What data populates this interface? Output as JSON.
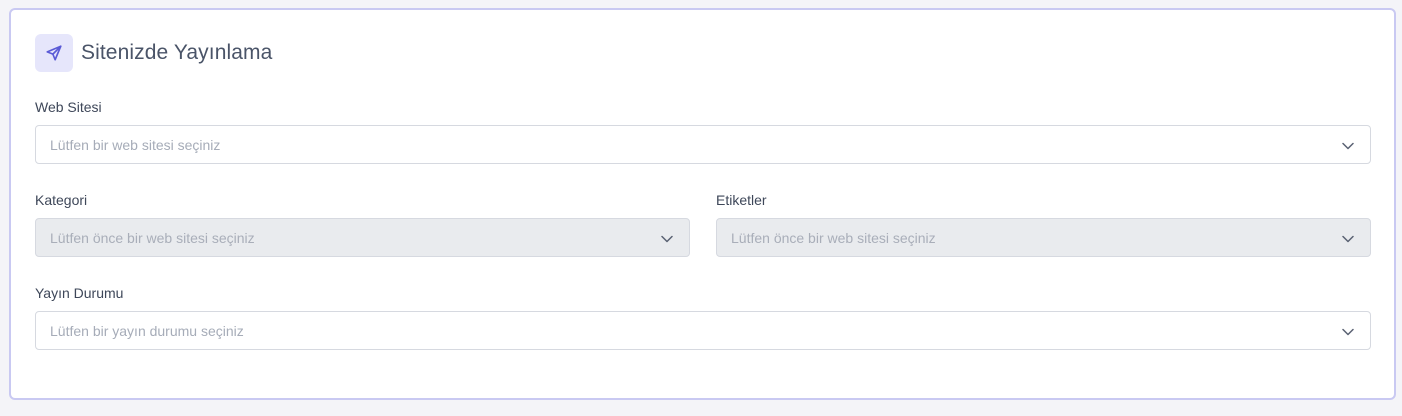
{
  "header": {
    "title": "Sitenizde Yayınlama",
    "icon": "paper-plane-icon",
    "icon_color": "#5b5bd6",
    "icon_bg": "#e6e6fb"
  },
  "fields": {
    "website": {
      "label": "Web Sitesi",
      "placeholder": "Lütfen bir web sitesi seçiniz",
      "disabled": false
    },
    "category": {
      "label": "Kategori",
      "placeholder": "Lütfen önce bir web sitesi seçiniz",
      "disabled": true
    },
    "tags": {
      "label": "Etiketler",
      "placeholder": "Lütfen önce bir web sitesi seçiniz",
      "disabled": true
    },
    "status": {
      "label": "Yayın Durumu",
      "placeholder": "Lütfen bir yayın durumu seçiniz",
      "disabled": false
    }
  },
  "colors": {
    "card_border": "#c9c9f2",
    "accent": "#5b5bd6",
    "disabled_bg": "#e9ebee"
  }
}
